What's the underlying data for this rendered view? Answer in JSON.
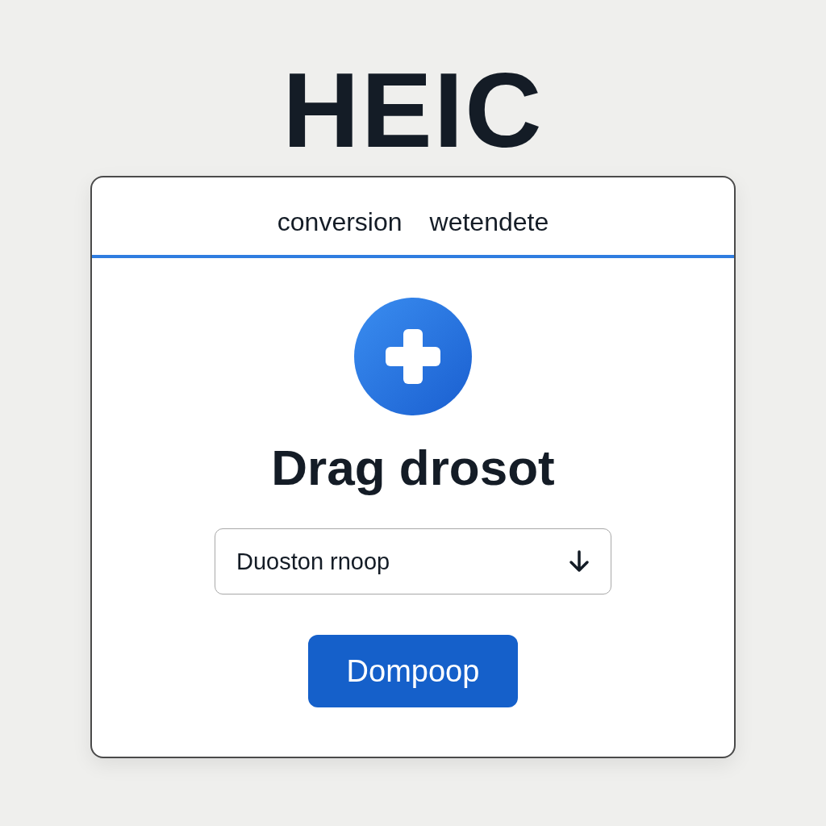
{
  "title": "HEIC",
  "card": {
    "header": [
      "conversion",
      "wetendete"
    ],
    "heading": "Drag drosot",
    "select": {
      "value": "Duoston rnoop"
    },
    "button": "Dompoop"
  }
}
